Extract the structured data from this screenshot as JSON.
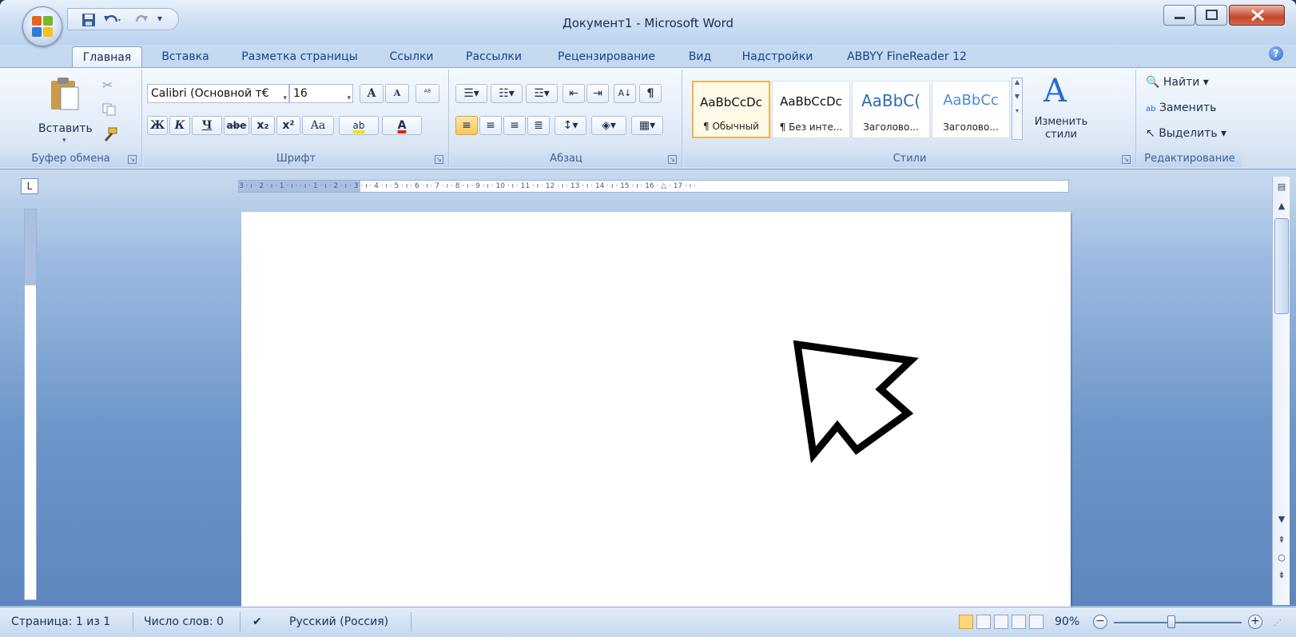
{
  "window": {
    "title": "Документ1 - Microsoft Word",
    "colors": {
      "accent": "#15428b",
      "ribbon_bg": "#e2ecf8",
      "close": "#c6452c",
      "doc_bg": "#6c96c9"
    }
  },
  "quick_access": {
    "icons": [
      "save-icon",
      "undo-icon",
      "redo-icon",
      "customize-qat-icon"
    ]
  },
  "tabs": [
    {
      "label": "Главная",
      "active": true
    },
    {
      "label": "Вставка"
    },
    {
      "label": "Разметка страницы"
    },
    {
      "label": "Ссылки"
    },
    {
      "label": "Рассылки"
    },
    {
      "label": "Рецензирование"
    },
    {
      "label": "Вид"
    },
    {
      "label": "Надстройки"
    },
    {
      "label": "ABBYY FineReader 12"
    }
  ],
  "clipboard": {
    "label": "Буфер обмена",
    "paste": "Вставить"
  },
  "font": {
    "label": "Шрифт",
    "font_name": "Calibri (Основной т€",
    "font_size": "16",
    "grow": "A",
    "shrink": "A",
    "bold": "Ж",
    "italic": "К",
    "underline": "Ч",
    "strike": "abe",
    "sub": "x₂",
    "sup": "x²",
    "case": "Aa",
    "highlight": "ab",
    "color": "A"
  },
  "paragraph": {
    "label": "Абзац",
    "pilcrow": "¶"
  },
  "styles": {
    "label": "Стили",
    "items": [
      {
        "sample": "AaBbCcDc",
        "name": "¶ Обычный",
        "selected": true
      },
      {
        "sample": "AaBbCcDc",
        "name": "¶ Без инте..."
      },
      {
        "sample": "AaBbC(",
        "name": "Заголово..."
      },
      {
        "sample": "AaBbCc",
        "name": "Заголово..."
      }
    ],
    "change_styles": "Изменить стили"
  },
  "editing": {
    "label": "Редактирование",
    "find": "Найти",
    "replace": "Заменить",
    "select": "Выделить"
  },
  "ruler": {
    "corner": "L",
    "marks": "3 · ı · 2 · ı · 1 · ı ·   · ı · 1 · ı · 2 · ı · 3 · ı · 4 · ı · 5 · ı · 6 · ı · 7 · ı · 8 · ı · 9 · ı · 10 · ı · 11 · ı · 12 · ı · 13 · ı · 14 · ı · 15 · ı · 16 · △ · 17 · ı ·"
  },
  "status": {
    "page": "Страница: 1 из 1",
    "words": "Число слов: 0",
    "language": "Русский (Россия)",
    "zoom": "90%",
    "zoom_level": 0.45
  }
}
